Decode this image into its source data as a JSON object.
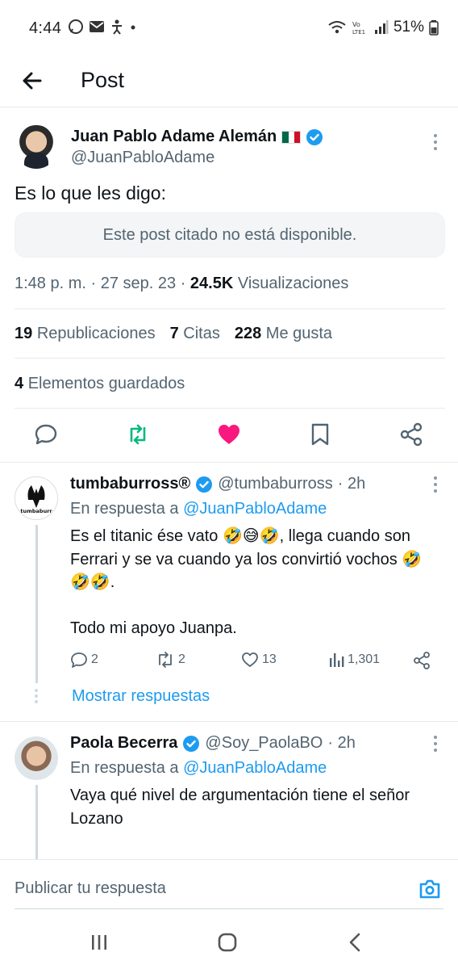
{
  "status_bar": {
    "time": "4:44",
    "battery": "51%",
    "icons": [
      "whatsapp-icon",
      "mail-icon",
      "accessibility-icon",
      "dot-icon",
      "wifi-icon",
      "volte-icon",
      "signal-icon",
      "battery-icon"
    ]
  },
  "header": {
    "title": "Post"
  },
  "post": {
    "author_name": "Juan Pablo Adame Alemán",
    "handle": "@JuanPabloAdame",
    "text": "Es lo que les digo:",
    "quoted_unavailable": "Este post citado no está disponible.",
    "time": "1:48 p. m.",
    "date": "27 sep. 23",
    "views_count": "24.5K",
    "views_label": "Visualizaciones",
    "reposts_count": "19",
    "reposts_label": "Republicaciones",
    "quotes_count": "7",
    "quotes_label": "Citas",
    "likes_count": "228",
    "likes_label": "Me gusta",
    "bookmarks_count": "4",
    "bookmarks_label": "Elementos guardados",
    "colors": {
      "repost": "#00ba7c",
      "like": "#f91880",
      "verified": "#1d9bf0"
    }
  },
  "replies": [
    {
      "name": "tumbaburross®",
      "handle": "@tumbaburross",
      "age": "· 2h",
      "reply_prefix": "En respuesta a",
      "reply_to": "@JuanPabloAdame",
      "text_line1": "Es el titanic ése vato 🤣😅🤣, llega cuando son Ferrari y se va cuando ya los convirtió vochos 🤣🤣🤣.",
      "text_line2": "Todo mi apoyo Juanpa.",
      "replies_count": "2",
      "reposts_count": "2",
      "likes_count": "13",
      "views_count": "1,301",
      "avatar_text": "tumbaburr",
      "show_replies": "Mostrar respuestas"
    },
    {
      "name": "Paola Becerra",
      "handle": "@Soy_PaolaBO",
      "age": "· 2h",
      "reply_prefix": "En respuesta a",
      "reply_to": "@JuanPabloAdame",
      "text_line1": "Vaya qué nivel de argumentación tiene el señor Lozano"
    }
  ],
  "compose": {
    "placeholder": "Publicar tu respuesta"
  }
}
